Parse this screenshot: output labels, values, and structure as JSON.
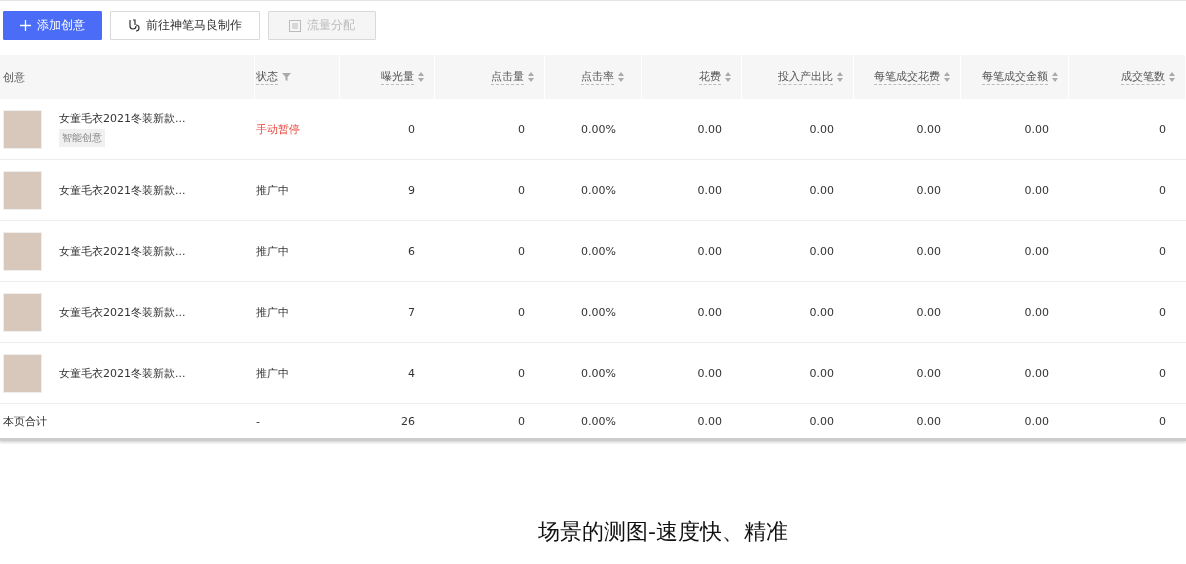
{
  "toolbar": {
    "buttons": [
      {
        "label": "添加创意",
        "kind": "primary",
        "disabled": false
      },
      {
        "label": "前往神笔马良制作",
        "kind": "default",
        "disabled": false
      },
      {
        "label": "流量分配",
        "kind": "default",
        "disabled": true
      }
    ]
  },
  "table": {
    "columns": [
      {
        "label": "创意",
        "sortable": false,
        "filterable": false
      },
      {
        "label": "状态",
        "sortable": false,
        "filterable": true
      },
      {
        "label": "曝光量",
        "sortable": true,
        "filterable": false
      },
      {
        "label": "点击量",
        "sortable": true,
        "filterable": false
      },
      {
        "label": "点击率",
        "sortable": true,
        "filterable": false
      },
      {
        "label": "花费",
        "sortable": true,
        "filterable": false
      },
      {
        "label": "投入产出比",
        "sortable": true,
        "filterable": false
      },
      {
        "label": "每笔成交花费",
        "sortable": true,
        "filterable": false
      },
      {
        "label": "每笔成交金额",
        "sortable": true,
        "filterable": false
      },
      {
        "label": "成交笔数",
        "sortable": true,
        "filterable": false
      }
    ],
    "rows": [
      {
        "tag": "智能创意",
        "kind": "paused",
        "cells": [
          "女童毛衣2021冬装新款...",
          "手动暂停",
          "0",
          "0",
          "0.00%",
          "0.00",
          "0.00",
          "0.00",
          "0.00",
          "0"
        ]
      },
      {
        "kind": "active",
        "cells": [
          "女童毛衣2021冬装新款...",
          "推广中",
          "9",
          "0",
          "0.00%",
          "0.00",
          "0.00",
          "0.00",
          "0.00",
          "0"
        ]
      },
      {
        "kind": "active",
        "cells": [
          "女童毛衣2021冬装新款...",
          "推广中",
          "6",
          "0",
          "0.00%",
          "0.00",
          "0.00",
          "0.00",
          "0.00",
          "0"
        ]
      },
      {
        "kind": "active",
        "cells": [
          "女童毛衣2021冬装新款...",
          "推广中",
          "7",
          "0",
          "0.00%",
          "0.00",
          "0.00",
          "0.00",
          "0.00",
          "0"
        ]
      },
      {
        "kind": "active",
        "cells": [
          "女童毛衣2021冬装新款...",
          "推广中",
          "4",
          "0",
          "0.00%",
          "0.00",
          "0.00",
          "0.00",
          "0.00",
          "0"
        ]
      }
    ],
    "summary": {
      "cells": [
        "本页合计",
        "-",
        "26",
        "0",
        "0.00%",
        "0.00",
        "0.00",
        "0.00",
        "0.00",
        "0"
      ]
    }
  },
  "caption": "场景的测图-速度快、精准"
}
